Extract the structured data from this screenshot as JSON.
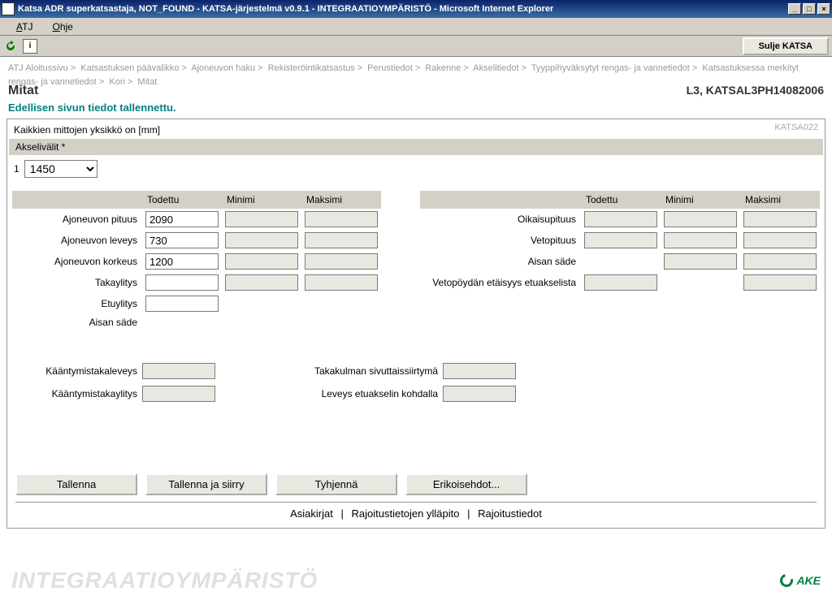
{
  "window": {
    "title": "Katsa ADR superkatsastaja, NOT_FOUND - KATSA-järjestelmä v0.9.1 - INTEGRAATIOYMPÄRISTÖ - Microsoft Internet Explorer"
  },
  "menu": {
    "atj": "ATJ",
    "ohje": "Ohje"
  },
  "toolbar": {
    "close_label": "Sulje KATSA"
  },
  "breadcrumb": {
    "items": [
      "ATJ Aloitussivu",
      "Katsastuksen päävalikko",
      "Ajoneuvon haku",
      "Rekisteröintikatsastus",
      "Perustiedot",
      "Rakenne",
      "Akselitiedot",
      "Tyyppihyväksytyt rengas- ja vannetiedot",
      "Katsastuksessa merkityt rengas- ja vannetiedot",
      "Kori",
      "Mitat"
    ]
  },
  "page": {
    "title": "Mitat",
    "vehicle": "L3, KATSAL3PH14082006",
    "saved_msg": "Edellisen sivun tiedot tallennettu.",
    "panel_id": "KATSA022",
    "unit_note": "Kaikkien mittojen yksikkö on [mm]",
    "axle_header": "Akselivälit *",
    "axle_index": "1",
    "axle_value": "1450"
  },
  "columns": {
    "todettu": "Todettu",
    "minimi": "Minimi",
    "maksimi": "Maksimi"
  },
  "left_rows": [
    {
      "label": "Ajoneuvon pituus",
      "todettu": "2090"
    },
    {
      "label": "Ajoneuvon leveys",
      "todettu": "730"
    },
    {
      "label": "Ajoneuvon korkeus",
      "todettu": "1200"
    },
    {
      "label": "Takaylitys",
      "todettu": ""
    },
    {
      "label": "Etuylitys",
      "todettu": ""
    },
    {
      "label": "Aisan säde",
      "todettu": ""
    }
  ],
  "right_rows": [
    {
      "label": "Oikaisupituus"
    },
    {
      "label": "Vetopituus"
    },
    {
      "label": "Aisan säde"
    },
    {
      "label": "Vetopöydän etäisyys etuakselista"
    }
  ],
  "extra": {
    "r1l": "Kääntymistakaleveys",
    "r1r": "Takakulman sivuttaissiirtymä",
    "r2l": "Kääntymistakaylitys",
    "r2r": "Leveys etuakselin kohdalla"
  },
  "buttons": {
    "save": "Tallenna",
    "save_move": "Tallenna ja siirry",
    "clear": "Tyhjennä",
    "special": "Erikoisehdot..."
  },
  "links": {
    "docs": "Asiakirjat",
    "restrict_edit": "Rajoitustietojen ylläpito",
    "restrict": "Rajoitustiedot"
  },
  "footer": {
    "env": "INTEGRAATIOYMPÄRISTÖ",
    "brand": "AKE"
  }
}
